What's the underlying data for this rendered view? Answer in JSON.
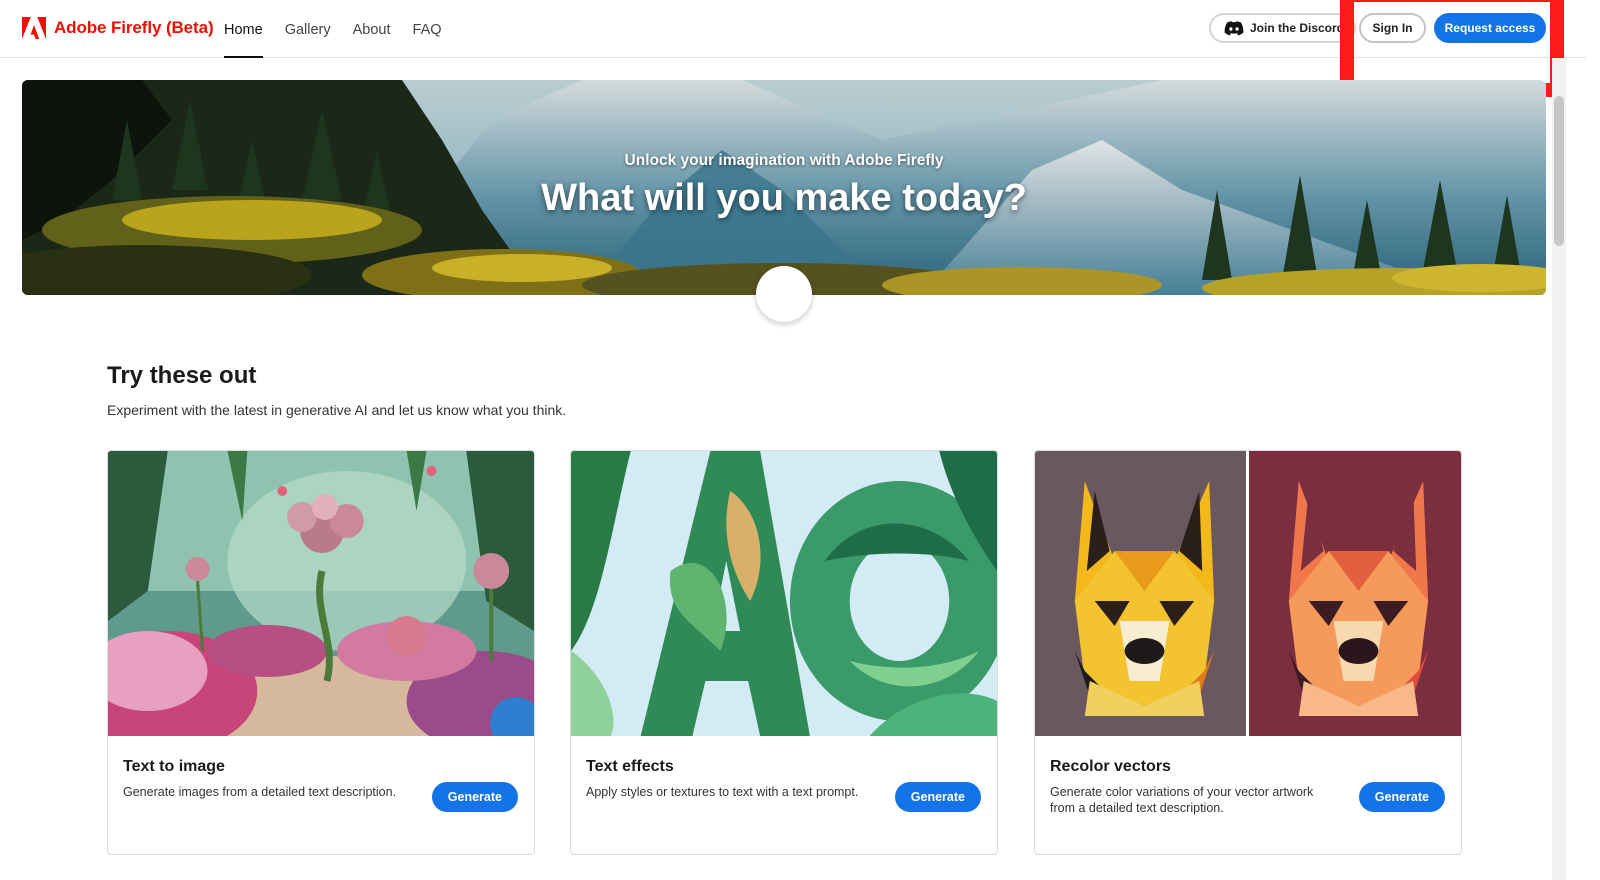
{
  "header": {
    "brand": "Adobe Firefly (Beta)",
    "nav": [
      "Home",
      "Gallery",
      "About",
      "FAQ"
    ],
    "discord_label": "Join the Discord",
    "signin_label": "Sign In",
    "request_label": "Request access"
  },
  "hero": {
    "kicker": "Unlock your imagination with Adobe Firefly",
    "title": "What will you make today?"
  },
  "section": {
    "title": "Try these out",
    "subtitle": "Experiment with the latest in generative AI and let us know what you think."
  },
  "cards": [
    {
      "title": "Text to image",
      "description": "Generate images from a detailed text description.",
      "button": "Generate"
    },
    {
      "title": "Text effects",
      "description": "Apply styles or textures to text with a text prompt.",
      "button": "Generate"
    },
    {
      "title": "Recolor vectors",
      "description": "Generate color variations of your vector artwork from a detailed text description.",
      "button": "Generate"
    }
  ],
  "colors": {
    "brand_red": "#eb1000",
    "accent_blue": "#1473e6",
    "highlight": "#ff1a1a"
  },
  "icons": {
    "logo": "adobe-logo-icon",
    "discord": "discord-icon"
  }
}
